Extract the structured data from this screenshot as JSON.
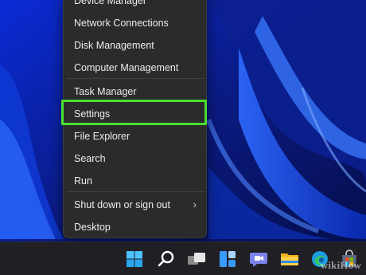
{
  "context_menu": {
    "items": [
      {
        "label": "Device Manager",
        "submenu": false
      },
      {
        "label": "Network Connections",
        "submenu": false
      },
      {
        "label": "Disk Management",
        "submenu": false
      },
      {
        "label": "Computer Management",
        "submenu": false
      },
      {
        "label": "Task Manager",
        "submenu": false
      },
      {
        "label": "Settings",
        "submenu": false,
        "highlighted": true
      },
      {
        "label": "File Explorer",
        "submenu": false
      },
      {
        "label": "Search",
        "submenu": false
      },
      {
        "label": "Run",
        "submenu": false
      },
      {
        "label": "Shut down or sign out",
        "submenu": true
      },
      {
        "label": "Desktop",
        "submenu": false
      }
    ],
    "submenu_glyph": "›",
    "highlight_color": "#4ae02e"
  },
  "taskbar": {
    "icons": [
      {
        "name": "start-icon"
      },
      {
        "name": "search-icon"
      },
      {
        "name": "task-view-icon"
      },
      {
        "name": "widgets-icon"
      },
      {
        "name": "teams-chat-icon"
      },
      {
        "name": "file-explorer-icon"
      },
      {
        "name": "edge-icon"
      },
      {
        "name": "store-icon"
      }
    ]
  },
  "watermark": {
    "text": "wikiHow"
  },
  "colors": {
    "wallpaper_dark": "#061050",
    "wallpaper_blue": "#1f4fff",
    "menu_bg": "#2b2b2b"
  }
}
